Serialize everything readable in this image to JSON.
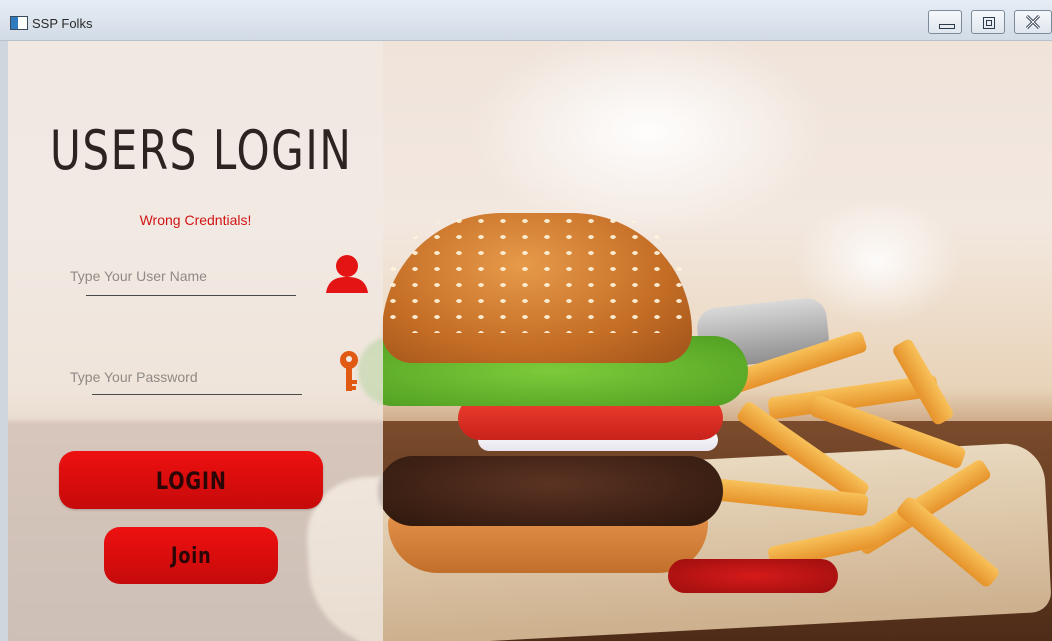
{
  "window": {
    "title": "SSP Folks"
  },
  "login": {
    "heading": "USERS LOGIN",
    "error": "Wrong Credntials!",
    "username_placeholder": "Type Your User Name",
    "password_placeholder": "Type Your Password",
    "login_label": "LOGIN",
    "join_label": "Join"
  },
  "icons": {
    "app": "app-icon",
    "user": "user-icon",
    "key": "key-icon",
    "minimize": "minimize-icon",
    "maximize": "maximize-icon",
    "close": "close-icon"
  },
  "colors": {
    "accent": "#e60f0f",
    "error_text": "#d01515",
    "heading": "#2b2421"
  }
}
